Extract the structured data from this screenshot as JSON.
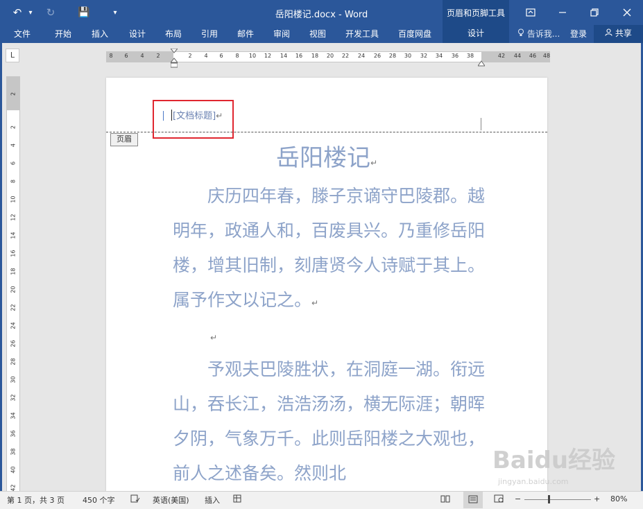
{
  "window": {
    "title": "岳阳楼记.docx - Word",
    "context_tools": "页眉和页脚工具",
    "context_tab": "设计"
  },
  "qat": {
    "undo": "↶",
    "undo_menu": "▾",
    "redo": "↻",
    "save": "💾",
    "customize": "▾"
  },
  "ribbon": {
    "tabs": [
      "文件",
      "开始",
      "插入",
      "设计",
      "布局",
      "引用",
      "邮件",
      "审阅",
      "视图",
      "开发工具",
      "百度网盘"
    ],
    "tell_me": "告诉我...",
    "login": "登录",
    "share": "共享"
  },
  "ruler": {
    "horizontal": [
      "8",
      "6",
      "4",
      "2",
      "2",
      "4",
      "6",
      "8",
      "10",
      "12",
      "14",
      "16",
      "18",
      "20",
      "22",
      "24",
      "26",
      "28",
      "30",
      "32",
      "34",
      "36",
      "38",
      "42",
      "44",
      "46",
      "48"
    ],
    "vertical": [
      "2",
      "2",
      "4",
      "6",
      "8",
      "10",
      "12",
      "14",
      "16",
      "18",
      "20",
      "22",
      "24",
      "26",
      "28",
      "30",
      "32",
      "34",
      "36",
      "38",
      "40",
      "42"
    ],
    "corner": "L"
  },
  "document": {
    "header_field": "[文档标题]",
    "header_label": "页眉",
    "heading": "岳阳楼记",
    "paragraphs": [
      "　　庆历四年春，滕子京谪守巴陵郡。越明年，政通人和，百废具兴。乃重修岳阳楼，增其旧制，刻唐贤今人诗赋于其上。属予作文以记之。",
      "",
      "　　予观夫巴陵胜状，在洞庭一湖。衔远山，吞长江，浩浩汤汤，横无际涯；朝晖夕阴，气象万千。此则岳阳楼之大观也，前人之述备矣。然则北"
    ],
    "para_mark": "↵"
  },
  "status": {
    "page": "第 1 页，共 3 页",
    "words": "450 个字",
    "language": "英语(美国)",
    "mode": "插入",
    "zoom": "80%",
    "zoom_minus": "−",
    "zoom_plus": "+"
  },
  "watermark": {
    "main": "Baidu经验",
    "sub": "jingyan.baidu.com"
  }
}
